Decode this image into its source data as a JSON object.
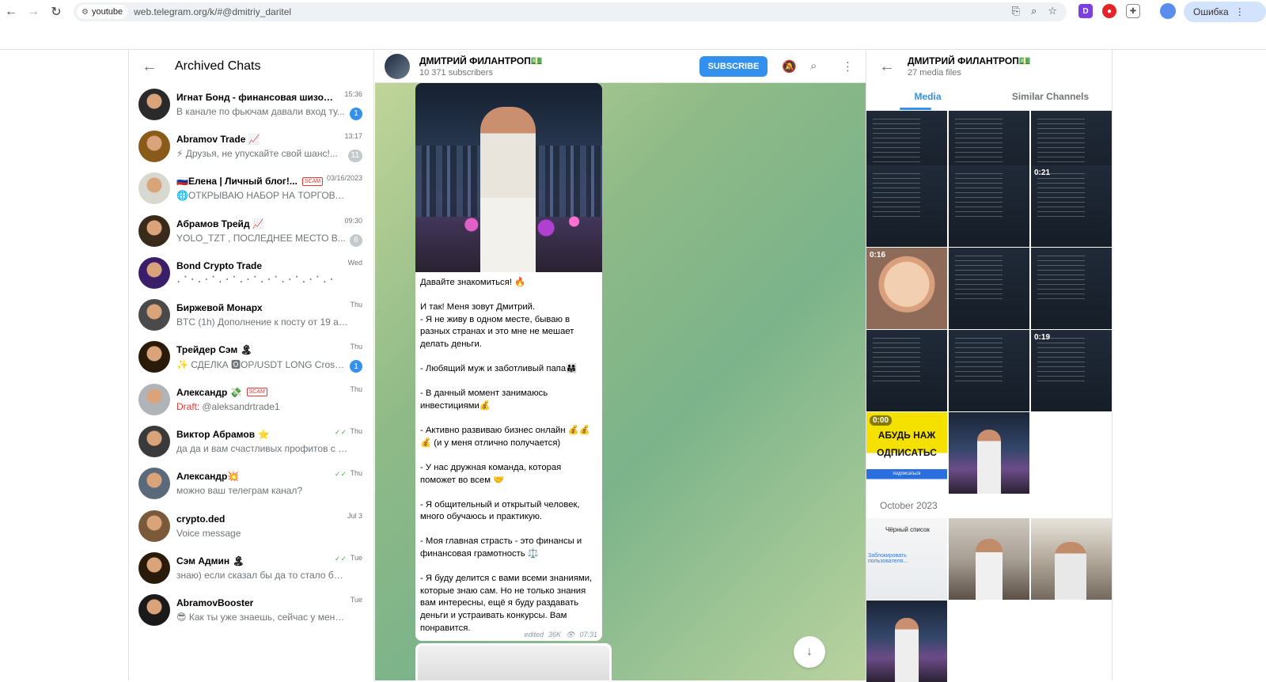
{
  "browser": {
    "site_chip": "youtube",
    "url": "web.telegram.org/k/#@dmitriy_daritel",
    "error_label": "Ошибка"
  },
  "archived": {
    "title": "Archived Chats",
    "chats": [
      {
        "name": "Игнат Бонд - финансовая шизофре...",
        "time": "15:36",
        "preview": "В канале по фьючам давали вход ту...",
        "badge": "1",
        "badge_type": "blue",
        "avatar": "#2a2a2a"
      },
      {
        "name": "Abramov Trade 📈",
        "time": "13:17",
        "preview": "⚡ Друзья, не упускайте свой шанс!...",
        "badge": "11",
        "badge_type": "gray",
        "avatar": "#8a5a1a"
      },
      {
        "name": "🇷🇺Елена | Личный блог!...",
        "time": "03/16/2023",
        "preview": "🌐ОТКРЫВАЮ НАБОР НА ТОРГОВУЮ СЕ...",
        "scam": "SCAM",
        "avatar": "#d8d8d0"
      },
      {
        "name": "Абрамов Трейд 📈",
        "time": "09:30",
        "preview": "YOLO_TZT , ПОСЛЕДНЕЕ МЕСТО В...",
        "badge": "6",
        "badge_type": "gray",
        "avatar": "#3a2a1a"
      },
      {
        "name": "Bond Crypto Trade",
        "time": "Wed",
        "preview": "⠄⠁⠂⠄⠂⠁⠄⠂⠁⠄⠂⠁⠄⠂⠁⠄⠂⠁⠄⠂⠁⠄⠂",
        "avatar": "#3a1e6a"
      },
      {
        "name": "Биржевой Монарх",
        "time": "Thu",
        "preview": "BTC (1h) Дополнение к посту от 19 ав...",
        "avatar": "#4a4a4a"
      },
      {
        "name": "Трейдер Сэм 🏝",
        "time": "Thu",
        "preview": "✨ СДЕЛКА 🅾OP/USDT LONG Cross ...",
        "badge": "1",
        "badge_type": "blue",
        "avatar": "#2a1a0a"
      },
      {
        "name": "Александр 💸",
        "time": "Thu",
        "preview": "@aleksandrtrade1",
        "draft": "Draft:",
        "scam": "SCAM",
        "avatar": "#b0b4b8"
      },
      {
        "name": "Виктор Абрамов ⭐",
        "time": "Thu",
        "preview": "да да и вам счастливых профитов с лох...",
        "ticks": "✓✓",
        "avatar": "#3a3a3a"
      },
      {
        "name": "Александр💥",
        "time": "Thu",
        "preview": "можно ваш телеграм канал?",
        "ticks": "✓✓",
        "avatar": "#5a6a7a"
      },
      {
        "name": "crypto.ded",
        "time": "Jul 3",
        "preview": "Voice message",
        "avatar": "#7a5a3a"
      },
      {
        "name": "Сэм Админ 🏝",
        "time": "Tue",
        "preview": "знаю) если сказал бы да то стало бы вс...",
        "ticks": "✓✓",
        "avatar": "#2a1a0a"
      },
      {
        "name": "AbramovBooster",
        "time": "Tue",
        "preview": "😎 Как ты уже знаешь, сейчас у меня ...",
        "avatar": "#1a1a1a"
      }
    ]
  },
  "channel": {
    "name": "ДМИТРИЙ ФИЛАНТРОП💵",
    "subscribers": "10 371 subscribers",
    "subscribe_label": "SUBSCRIBE",
    "message_text": "Давайте знакомиться! 🔥\n\nИ так! Меня зовут Дмитрий.\n- Я не живу в одном месте, бываю в разных странах и это мне не мешает делать деньги.\n\n- Любящий муж и заботливый папа👨‍👩‍👧\n\n- В данный момент занимаюсь инвестициями💰\n\n- Активно развиваю бизнес онлайн 💰💰💰 (и у меня отлично получается)\n\n- У нас дружная команда, которая поможет во всем 🤝\n\n- Я общительный и открытый человек, много обучаюсь и практикую.\n\n- Моя главная страсть - это финансы и финансовая грамотность ⚖️\n\n- Я буду делится с вами всеми знаниями, которые знаю сам. Но не только знания вам интересны, ещё я буду раздавать деньги и устраивать конкурсы. Вам понравится.",
    "message_edited": "edited",
    "message_views": "36K",
    "message_time": "07:31"
  },
  "media_panel": {
    "title": "ДМИТРИЙ ФИЛАНТРОП💵",
    "subtitle": "27 media files",
    "tab_media": "Media",
    "tab_similar": "Similar Channels",
    "month_label": "October 2023",
    "durations": [
      "0:21",
      "0:16",
      "0:19",
      "0:00"
    ],
    "promo_text": [
      "АБУДЬ НАЖ",
      "ОДПИСАТЬС",
      "подписаться"
    ],
    "list_text": [
      "Чёрный список",
      "Заблокировать пользователя..."
    ]
  }
}
